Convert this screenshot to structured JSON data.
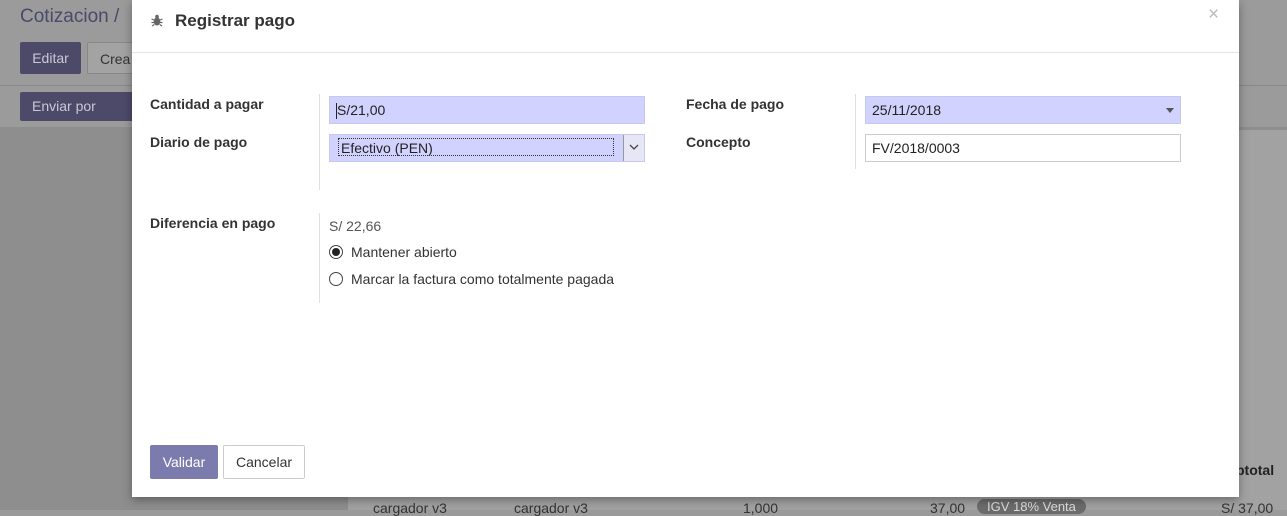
{
  "background": {
    "breadcrumb": "Cotizacion /",
    "edit_button": "Editar",
    "create_button": "Crea",
    "send_email_button": "Enviar por Email",
    "table_header_subtotal": "btotal",
    "row": {
      "product": "cargador v3",
      "description": "cargador v3",
      "quantity": "1,000",
      "price": "37,00",
      "tax": "IGV 18% Venta",
      "subtotal": "S/ 37,00"
    }
  },
  "dialog": {
    "title": "Registrar pago",
    "close": "×",
    "fields": {
      "amount_label": "Cantidad a pagar",
      "amount_value": "S/21,00",
      "journal_label": "Diario de pago",
      "journal_value": "Efectivo (PEN)",
      "date_label": "Fecha de pago",
      "date_value": "25/11/2018",
      "memo_label": "Concepto",
      "memo_value": "FV/2018/0003"
    },
    "difference": {
      "label": "Diferencia en pago",
      "amount": "S/ 22,66",
      "options": [
        {
          "label": "Mantener abierto",
          "checked": true
        },
        {
          "label": "Marcar la factura como totalmente pagada",
          "checked": false
        }
      ]
    },
    "buttons": {
      "validate": "Validar",
      "cancel": "Cancelar"
    }
  },
  "colors": {
    "primary": "#7c7bad",
    "required_field": "#d2d2ff"
  }
}
